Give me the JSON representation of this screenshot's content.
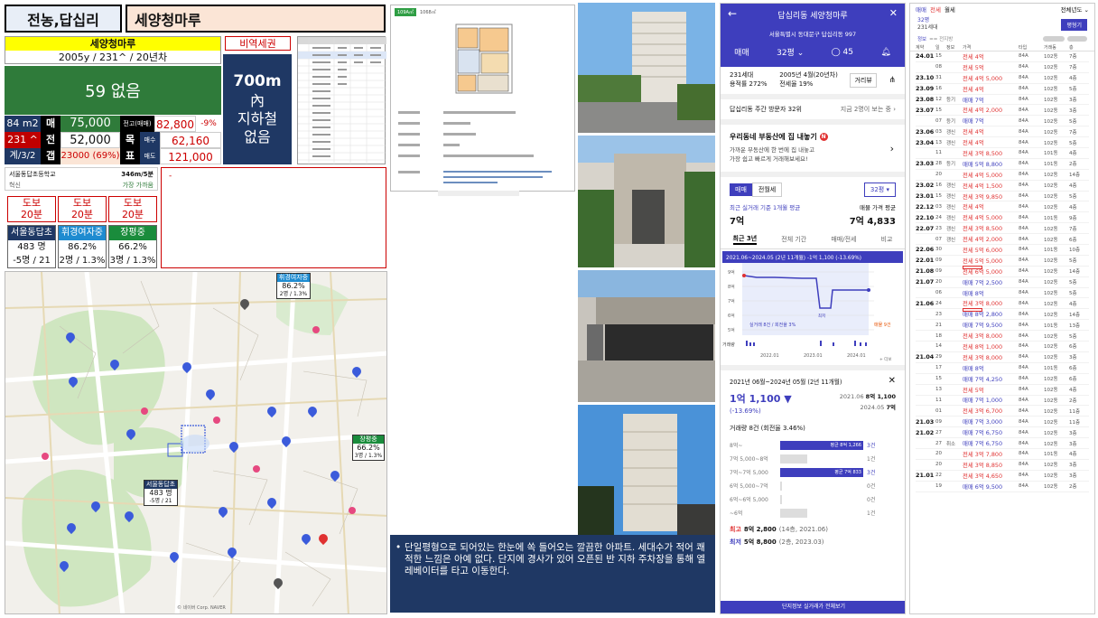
{
  "region": "전농,답십리",
  "apt_name": "세양청마루",
  "info_name": "세양청마루",
  "info_sub": "2005y / 231^ / 20년차",
  "tag_label": "비역세권",
  "green_box_text": "59 없음",
  "metro": {
    "dist": "700m",
    "line1": "內",
    "line2": "지하철",
    "line3": "없음"
  },
  "size_area": "84 m2",
  "size_units": "231 ^",
  "size_floors": "계/3/2",
  "price_rows": [
    {
      "label": "매",
      "value": "75,000",
      "tag": "전고(매매)",
      "tag2": "82,800",
      "pct": "-9%"
    },
    {
      "label": "전",
      "value": "52,000",
      "tag": "목",
      "tag2": "매수",
      "pct": "62,160"
    },
    {
      "label": "갭",
      "value": "23000 (69%)",
      "tag": "표",
      "tag2": "매도",
      "pct": "121,000"
    }
  ],
  "school": {
    "name": "서울동답초등학교",
    "dist": "346m/5분",
    "type": "혁신",
    "note": "가장 가까움"
  },
  "walk_boxes": [
    {
      "l1": "도보",
      "l2": "20분"
    },
    {
      "l1": "도보",
      "l2": "20분"
    },
    {
      "l1": "도보",
      "l2": "20분"
    }
  ],
  "school_cards": [
    {
      "name": "서울동답초",
      "v1": "483 명",
      "v2": "-5명 / 21",
      "color": "#1f3864"
    },
    {
      "name": "휘경여자중",
      "v1": "86.2%",
      "v2": "2명 / 1.3%",
      "color": "#1e8bd0"
    },
    {
      "name": "장평중",
      "v1": "66.2%",
      "v2": "3명 / 1.3%",
      "color": "#1a8c3c"
    }
  ],
  "empty_box_mark": "-",
  "map_labels": {
    "school1_name": "휘경여자중",
    "school1_v1": "86.2%",
    "school1_v2": "2명 / 1.3%",
    "school2_name": "장평중",
    "school2_v1": "66.2%",
    "school2_v2": "3명 / 1.3%",
    "school3_name": "서울동답초",
    "school3_v1": "483 명",
    "school3_v2": "-5명 / 21",
    "credit": "© 네이버 Corp. NAVER"
  },
  "floorplan": {
    "badge": "109A㎡",
    "size": "1068㎡"
  },
  "caption": "단일평형으로 되어있는 한눈에 쏙 들어오는 깔끔한 아파트. 세대수가 적어 쾌적한 느낌은 아예 없다. 단지에 경사가 있어 오픈된 반 지하 주차장을 통해 엘레베이터를 타고 이동한다.",
  "mobile": {
    "title": "답십리동 세양청마루",
    "address": "서울특별시 동대문구 답십리동 997",
    "tab_deal": "매매",
    "tab_size": "32평",
    "comments": "45",
    "units": "231세대",
    "ratio": "용적률 272%",
    "built": "2005년 4월(20년차)",
    "lease_ratio": "전세율 19%",
    "distance_btn": "거리뷰",
    "visitors": "답십리동 주간 방문자 32위",
    "visitors_sub": "지금 2명이 보는 중",
    "promo_title": "우리동네 부동산에 집 내놓기",
    "promo_new": "N",
    "promo_sub1": "가까운 부동산에 한 번에 집 내놓고",
    "promo_sub2": "가장 쉽고 빠르게 거래해보세요!",
    "seg_a": "매매",
    "seg_b": "전월세",
    "size_sel": "32평",
    "recent_label": "최근 실거래 기준 1개월 평균",
    "recent_value": "7억",
    "ask_label": "매물 가격 평균",
    "ask_value": "7억 4,833",
    "tabs": [
      "최근 3년",
      "전체 기간",
      "매매/전세",
      "비교"
    ],
    "chart_title": "2021.06~2024.05 (2년 11개월) -1억 1,100 (-13.69%)",
    "chart_legend": "실거래 8건 / 회전율 3%",
    "chart_low": "최저",
    "chart_high": "매물 9건",
    "chart_ylabels": [
      "9억",
      "8억",
      "7억",
      "6억",
      "5억"
    ],
    "chart_xlabels": [
      "2022.01",
      "2023.01",
      "2024.01"
    ],
    "chart_vol": "거래량",
    "chart_more": "+ 더보",
    "sheet_title": "2021년 06월~2024년 05월 (2년 11개월)",
    "change_value": "1억 1,100 ▼",
    "change_pct": "(-13.69%)",
    "from_date": "2021.06",
    "from_val": "8억 1,100",
    "to_date": "2024.05",
    "to_val": "7억",
    "vol_text": "거래량 8건 (회전율 3.46%)",
    "dist": [
      {
        "label": "8억~",
        "pct": 100,
        "inner": "평균 8억 1,266",
        "count": "3건",
        "hl": true
      },
      {
        "label": "7억 5,000~8억",
        "pct": 33,
        "inner": "",
        "count": "1건",
        "hl": false
      },
      {
        "label": "7억~7억 5,000",
        "pct": 100,
        "inner": "평균 7억 833",
        "count": "3건",
        "hl": true
      },
      {
        "label": "6억 5,000~7억",
        "pct": 0,
        "inner": "",
        "count": "0건",
        "hl": false
      },
      {
        "label": "6억~6억 5,000",
        "pct": 0,
        "inner": "",
        "count": "0건",
        "hl": false
      },
      {
        "label": "~6억",
        "pct": 33,
        "inner": "",
        "count": "1건",
        "hl": false
      }
    ],
    "high_label": "최고",
    "high_value": "8억 2,800",
    "high_sub": "(14층, 2021.06)",
    "low_label": "최저",
    "low_value": "5억 8,800",
    "low_sub": "(2층, 2023.03)",
    "bottom_btn": "단지정보 실거래가 전체보기"
  },
  "trades": {
    "tabs": [
      "매매",
      "전세",
      "월세"
    ],
    "filter": "전체년도",
    "size": "32평",
    "units": "231세대",
    "btn": "평형기",
    "col_info": "정보",
    "col_all": "== 전지방",
    "headers": [
      "계약",
      "일",
      "정보",
      "가격",
      "타입",
      "거래동",
      "층"
    ],
    "rows": [
      [
        "24.01",
        "15",
        "",
        "전세 4억",
        "84A",
        "102동",
        "7층",
        false
      ],
      [
        "",
        "08",
        "",
        "전세 5억",
        "84A",
        "102동",
        "7층",
        false
      ],
      [
        "23.10",
        "31",
        "",
        "전세 4억 5,000",
        "84A",
        "102동",
        "4층",
        false
      ],
      [
        "23.09",
        "16",
        "",
        "전세 4억",
        "84A",
        "102동",
        "5층",
        false
      ],
      [
        "23.08",
        "12",
        "등기",
        "매매 7억",
        "84A",
        "102동",
        "3층",
        false
      ],
      [
        "23.07",
        "15",
        "",
        "전세 4억 2,000",
        "84A",
        "102동",
        "3층",
        false
      ],
      [
        "",
        "07",
        "등기",
        "매매 7억",
        "84A",
        "102동",
        "5층",
        false
      ],
      [
        "23.06",
        "03",
        "갱신",
        "전세 4억",
        "84A",
        "102동",
        "7층",
        false
      ],
      [
        "23.04",
        "13",
        "갱신",
        "전세 4억",
        "84A",
        "102동",
        "5층",
        false
      ],
      [
        "",
        "11",
        "",
        "전세 3억 8,500",
        "84A",
        "101동",
        "4층",
        false
      ],
      [
        "23.03",
        "28",
        "등기",
        "매매 5억 8,800",
        "84A",
        "101동",
        "2층",
        false
      ],
      [
        "",
        "20",
        "",
        "전세 4억 5,000",
        "84A",
        "102동",
        "14층",
        false
      ],
      [
        "23.02",
        "16",
        "갱신",
        "전세 4억 1,500",
        "84A",
        "102동",
        "4층",
        false
      ],
      [
        "23.01",
        "15",
        "갱신",
        "전세 3억 9,850",
        "84A",
        "102동",
        "5층",
        false
      ],
      [
        "22.12",
        "03",
        "갱신",
        "전세 4억",
        "84A",
        "102동",
        "4층",
        false
      ],
      [
        "22.10",
        "24",
        "갱신",
        "전세 4억 5,000",
        "84A",
        "101동",
        "9층",
        false
      ],
      [
        "22.07",
        "23",
        "갱신",
        "전세 3억 8,500",
        "84A",
        "102동",
        "7층",
        false
      ],
      [
        "",
        "07",
        "갱신",
        "전세 4억 2,000",
        "84A",
        "102동",
        "6층",
        false
      ],
      [
        "22.06",
        "30",
        "",
        "전세 5억 6,000",
        "84A",
        "101동",
        "10층",
        false
      ],
      [
        "22.01",
        "09",
        "",
        "전세 5억 5,000",
        "84A",
        "102동",
        "5층",
        false
      ],
      [
        "21.08",
        "09",
        "",
        "전세 6억 5,000",
        "84A",
        "102동",
        "14층",
        true
      ],
      [
        "21.07",
        "20",
        "",
        "매매 7억 2,500",
        "84A",
        "102동",
        "5층",
        false
      ],
      [
        "",
        "06",
        "",
        "매매 8억",
        "84A",
        "102동",
        "5층",
        false
      ],
      [
        "21.06",
        "24",
        "",
        "전세 3억 8,000",
        "84A",
        "102동",
        "4층",
        false
      ],
      [
        "",
        "23",
        "",
        "매매 8억 2,800",
        "84A",
        "102동",
        "14층",
        true
      ],
      [
        "",
        "21",
        "",
        "매매 7억 9,500",
        "84A",
        "101동",
        "13층",
        false
      ],
      [
        "",
        "18",
        "",
        "전세 3억 8,000",
        "84A",
        "102동",
        "5층",
        false
      ],
      [
        "",
        "14",
        "",
        "전세 8억 1,000",
        "84A",
        "102동",
        "6층",
        false
      ],
      [
        "21.04",
        "29",
        "",
        "전세 3억 8,000",
        "84A",
        "102동",
        "3층",
        false
      ],
      [
        "",
        "17",
        "",
        "매매 8억",
        "84A",
        "101동",
        "6층",
        false
      ],
      [
        "",
        "15",
        "",
        "매매 7억 4,250",
        "84A",
        "102동",
        "6층",
        false
      ],
      [
        "",
        "13",
        "",
        "전세 5억",
        "84A",
        "102동",
        "4층",
        false
      ],
      [
        "",
        "11",
        "",
        "매매 7억 1,000",
        "84A",
        "102동",
        "2층",
        false
      ],
      [
        "",
        "01",
        "",
        "전세 3억 6,700",
        "84A",
        "102동",
        "11층",
        false
      ],
      [
        "21.03",
        "09",
        "",
        "매매 7억 3,000",
        "84A",
        "102동",
        "11층",
        false
      ],
      [
        "21.02",
        "27",
        "",
        "매매 7억 6,750",
        "84A",
        "102동",
        "3층",
        false
      ],
      [
        "",
        "27",
        "취소",
        "매매 7억 6,750",
        "84A",
        "102동",
        "3층",
        false
      ],
      [
        "",
        "20",
        "",
        "전세 3억 7,800",
        "84A",
        "101동",
        "4층",
        false
      ],
      [
        "",
        "20",
        "",
        "전세 3억 8,850",
        "84A",
        "102동",
        "3층",
        false
      ],
      [
        "21.01",
        "22",
        "",
        "전세 3억 4,650",
        "84A",
        "102동",
        "3층",
        false
      ],
      [
        "",
        "19",
        "",
        "매매 6억 9,500",
        "84A",
        "102동",
        "2층",
        false
      ]
    ]
  },
  "colors": {
    "green": "#2f7b3a",
    "navy": "#1f3864",
    "red": "#c00000",
    "blue_hdr": "#4338ca",
    "pink": "#fbe5d6",
    "yellow": "#ffff00"
  }
}
